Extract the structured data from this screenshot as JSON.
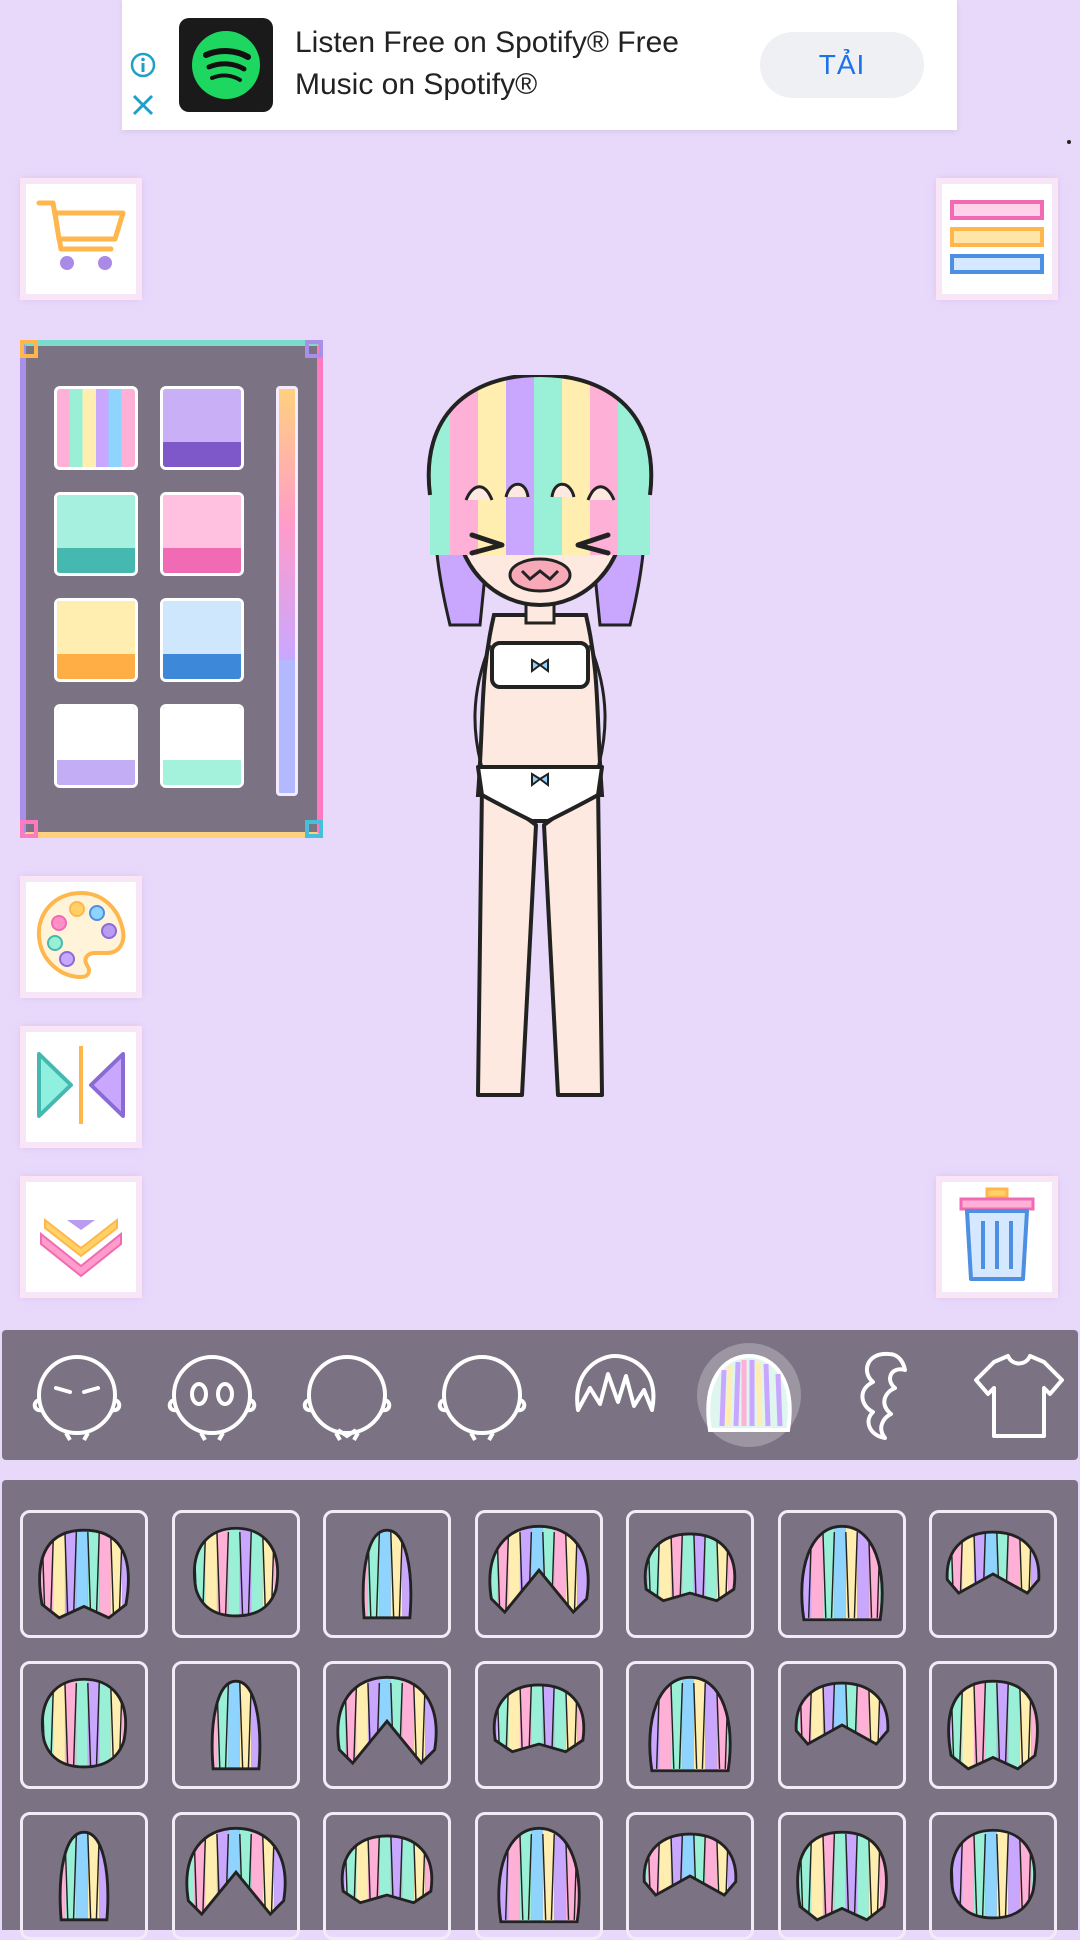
{
  "ad": {
    "title": "Listen Free on Spotify® Free Music on Spotify®",
    "button_label": "TẢI",
    "logo_icon": "spotify-logo",
    "info_icon": "info-icon",
    "close_icon": "close-icon"
  },
  "side_buttons": {
    "shop_icon": "shopping-cart-icon",
    "menu_icon": "menu-icon",
    "palette_icon": "color-palette-icon",
    "flip_icon": "flip-icon",
    "collapse_icon": "chevron-down-icon",
    "trash_icon": "trash-icon"
  },
  "color_panel": {
    "swatches": [
      {
        "name": "rainbow",
        "top": "rainbow",
        "bottom": "rainbow"
      },
      {
        "name": "purple",
        "top": "#c9b0f6",
        "bottom": "#7e58c9"
      },
      {
        "name": "mint",
        "top": "#a5f0df",
        "bottom": "#45b8b0"
      },
      {
        "name": "pink",
        "top": "#ffc1df",
        "bottom": "#f06ab4"
      },
      {
        "name": "yellow",
        "top": "#ffeeaf",
        "bottom": "#ffae45"
      },
      {
        "name": "blue",
        "top": "#cfe7fc",
        "bottom": "#3d88d9"
      },
      {
        "name": "white-lavender",
        "top": "#ffffff",
        "bottom": "#c3adf4"
      },
      {
        "name": "white-mint",
        "top": "#ffffff",
        "bottom": "#a5f2dc"
      }
    ],
    "slider_level": 0.67
  },
  "categories": [
    {
      "icon": "face-closed-eyes-icon"
    },
    {
      "icon": "face-eyes-icon"
    },
    {
      "icon": "face-mouth-icon"
    },
    {
      "icon": "face-blank-icon"
    },
    {
      "icon": "hair-short-icon"
    },
    {
      "icon": "hair-bangs-icon",
      "selected": true
    },
    {
      "icon": "hair-long-icon"
    },
    {
      "icon": "shirt-icon"
    }
  ],
  "hair_items_count": 21,
  "colors": {
    "background": "#e8d9fb",
    "panel": "#7b7283",
    "accent_blue": "#1a73e8",
    "spotify_green": "#1ed760"
  }
}
